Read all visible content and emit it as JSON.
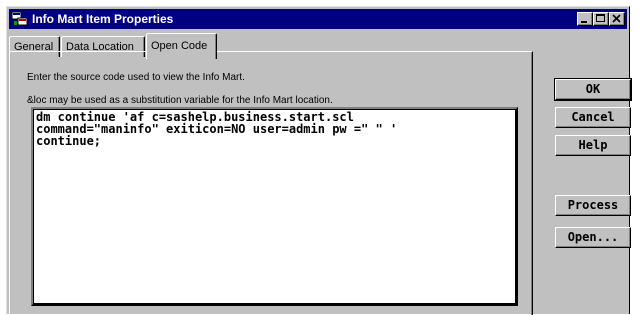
{
  "window": {
    "title": "Info Mart Item Properties",
    "icon": "sas-app-icon",
    "controls": [
      "minimize-icon",
      "maximize-icon",
      "close-icon"
    ]
  },
  "tabs": [
    {
      "label": "General",
      "active": false
    },
    {
      "label": "Data Location",
      "active": false
    },
    {
      "label": "Open Code",
      "active": true
    }
  ],
  "panel": {
    "instruction": "Enter the source code used to view the Info Mart.",
    "hint": "&loc may be used as a substitution variable for the Info Mart location.",
    "code_lines": [
      "dm continue 'af c=sashelp.business.start.scl",
      "command=\"maninfo\" exiticon=NO user=admin pw =\" \" '",
      "continue;"
    ]
  },
  "buttons": {
    "ok": "OK",
    "cancel": "Cancel",
    "help": "Help",
    "process": "Process",
    "open": "Open..."
  },
  "colors": {
    "titlebar": "#000080",
    "face": "#c0c0c0"
  }
}
